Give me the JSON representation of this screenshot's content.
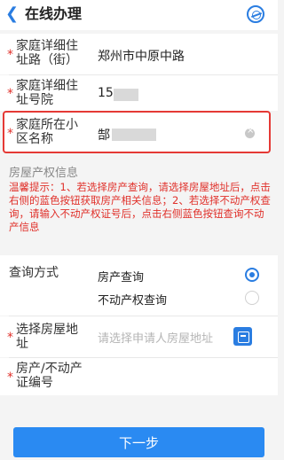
{
  "header": {
    "title": "在线办理"
  },
  "form": {
    "street_label": "家庭详细住址路（街）",
    "street_value": "郑州市中原中路",
    "house_label": "家庭详细住址号院",
    "house_value": "15",
    "community_label": "家庭所在小区名称",
    "community_value": "郜",
    "required_mark": "*"
  },
  "section": {
    "title": "房屋产权信息",
    "tip": "温馨提示：1、若选择房产查询，请选择房屋地址后，点击右侧的蓝色按钮获取房产相关信息；2、若选择不动产权查询，请输入不动产权证号后，点击右侧蓝色按钮查询不动产信息"
  },
  "query": {
    "label": "查询方式",
    "options": [
      {
        "label": "房产查询",
        "selected": true
      },
      {
        "label": "不动产权查询",
        "selected": false
      }
    ]
  },
  "address": {
    "label": "选择房屋地址",
    "placeholder": "请选择申请人房屋地址"
  },
  "cert": {
    "label": "房产/不动产证编号"
  },
  "footer": {
    "next_label": "下一步"
  },
  "colors": {
    "accent": "#2a7de1",
    "required": "#e0302a",
    "highlight_border": "#e53935"
  }
}
